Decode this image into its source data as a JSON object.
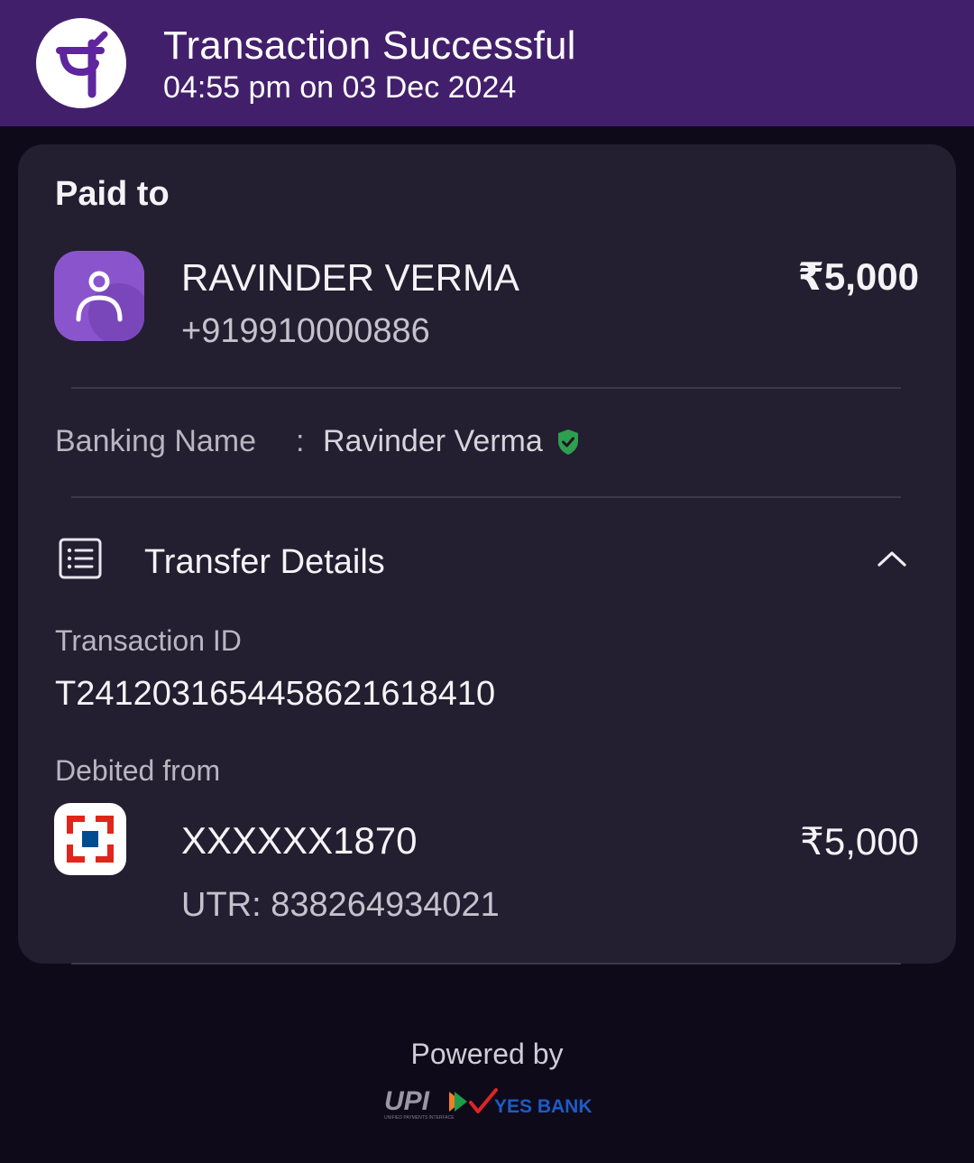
{
  "header": {
    "title": "Transaction Successful",
    "subtitle": "04:55 pm on 03 Dec 2024",
    "logo_icon": "phonepe-logo-icon"
  },
  "card": {
    "paid_to_label": "Paid to",
    "payee": {
      "name": "RAVINDER VERMA",
      "phone": "+919910000886",
      "amount": "₹5,000",
      "avatar_icon": "person-icon"
    },
    "banking_name": {
      "label": "Banking Name",
      "separator": ":",
      "value": "Ravinder Verma",
      "verified_icon": "verified-shield-icon"
    },
    "transfer_details": {
      "title": "Transfer Details",
      "icon": "receipt-list-icon",
      "toggle_icon": "chevron-up-icon",
      "transaction_id_label": "Transaction ID",
      "transaction_id": "T2412031654458621618410",
      "debited_from_label": "Debited from",
      "account": "XXXXXX1870",
      "amount": "₹5,000",
      "utr": "UTR: 838264934021",
      "bank_icon": "hdfc-bank-icon"
    }
  },
  "footer": {
    "powered_by": "Powered by",
    "upi_logo": "UPI",
    "upi_tagline": "UNIFIED PAYMENTS INTERFACE",
    "bank_logo": "YES BANK"
  },
  "colors": {
    "header_bg": "#421f6b",
    "page_bg": "#0f0a1a",
    "card_bg": "#231e30",
    "accent_purple": "#5f259f",
    "avatar_bg": "#8a55cc",
    "verified_green": "#2e9e4f",
    "bank_red": "#e1251b",
    "bank_blue": "#004c8f",
    "yes_bank_blue": "#1d5cc7",
    "yes_bank_red": "#e02424"
  }
}
